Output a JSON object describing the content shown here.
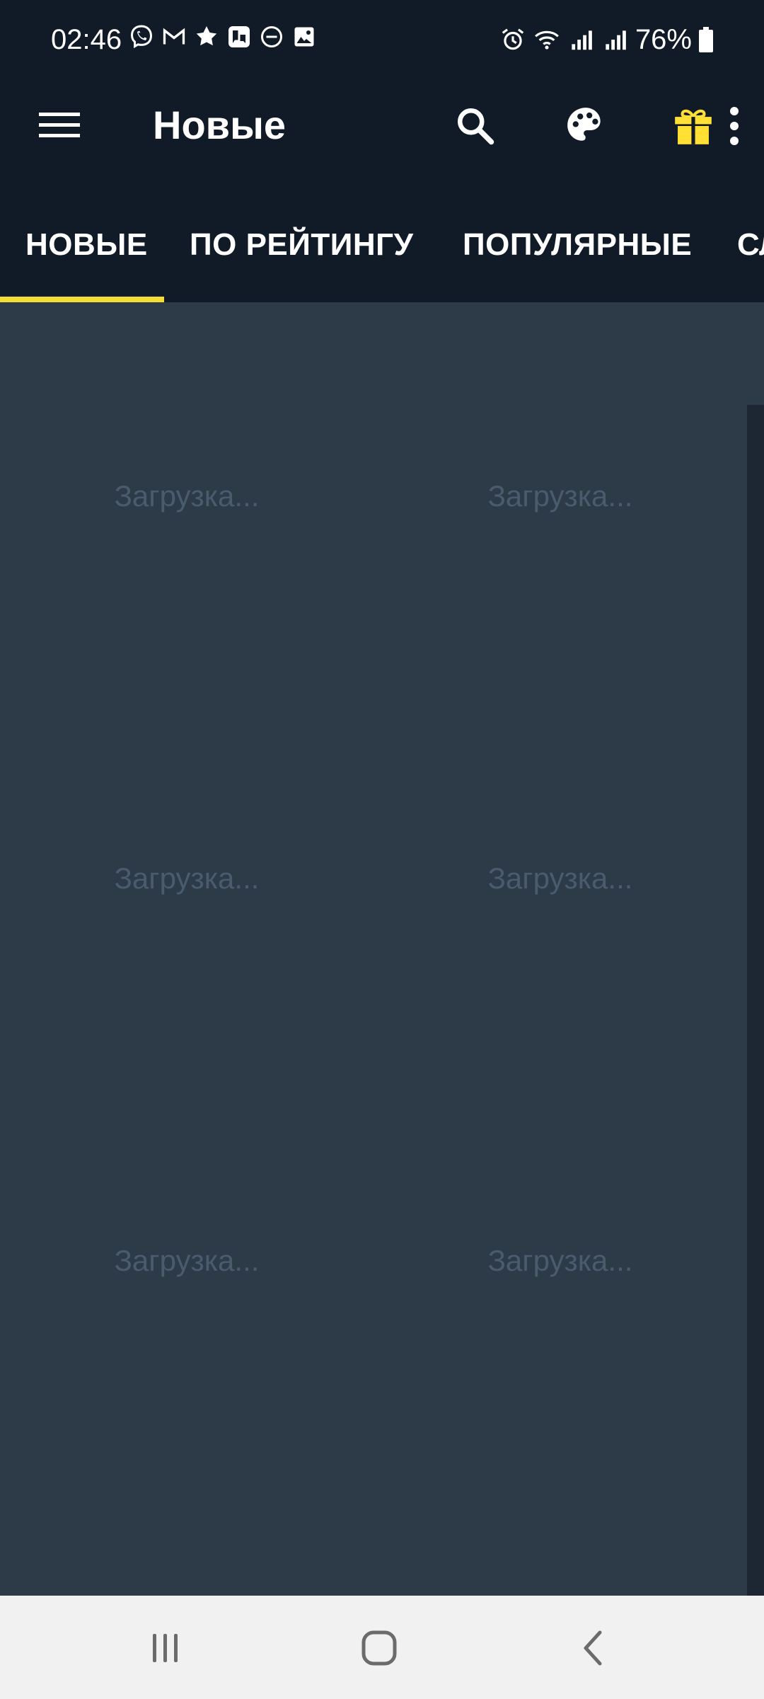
{
  "status_bar": {
    "time": "02:46",
    "notification_icons": [
      "viber-icon",
      "gmail-icon",
      "star-badge-icon",
      "messenger-icon",
      "do-not-disturb-icon",
      "image-icon"
    ],
    "system_icons": [
      "alarm-icon",
      "wifi-icon",
      "signal-icon",
      "signal-icon"
    ],
    "battery_percent": "76%"
  },
  "app_bar": {
    "title": "Новые",
    "actions": [
      "search-icon",
      "palette-icon",
      "gift-icon",
      "more-vert-icon"
    ]
  },
  "tabs": [
    {
      "label": "НОВЫЕ",
      "selected": true
    },
    {
      "label": "ПО РЕЙТИНГУ",
      "selected": false
    },
    {
      "label": "ПОПУЛЯРНЫЕ",
      "selected": false
    },
    {
      "label": "СЛ",
      "selected": false
    }
  ],
  "grid": {
    "columns": 2,
    "items": [
      {
        "text": "Загрузка..."
      },
      {
        "text": "Загрузка..."
      },
      {
        "text": "Загрузка..."
      },
      {
        "text": "Загрузка..."
      },
      {
        "text": "Загрузка..."
      },
      {
        "text": "Загрузка..."
      }
    ]
  },
  "nav_bar": {
    "buttons": [
      "recent-apps-icon",
      "home-icon",
      "back-icon"
    ]
  },
  "colors": {
    "header_bg": "#111b28",
    "content_bg": "#2d3a48",
    "tab_indicator": "#f5dd35",
    "gift_accent": "#ffe033",
    "loading_text": "#4a5b6e",
    "nav_bar_bg": "#f1f1f1"
  }
}
